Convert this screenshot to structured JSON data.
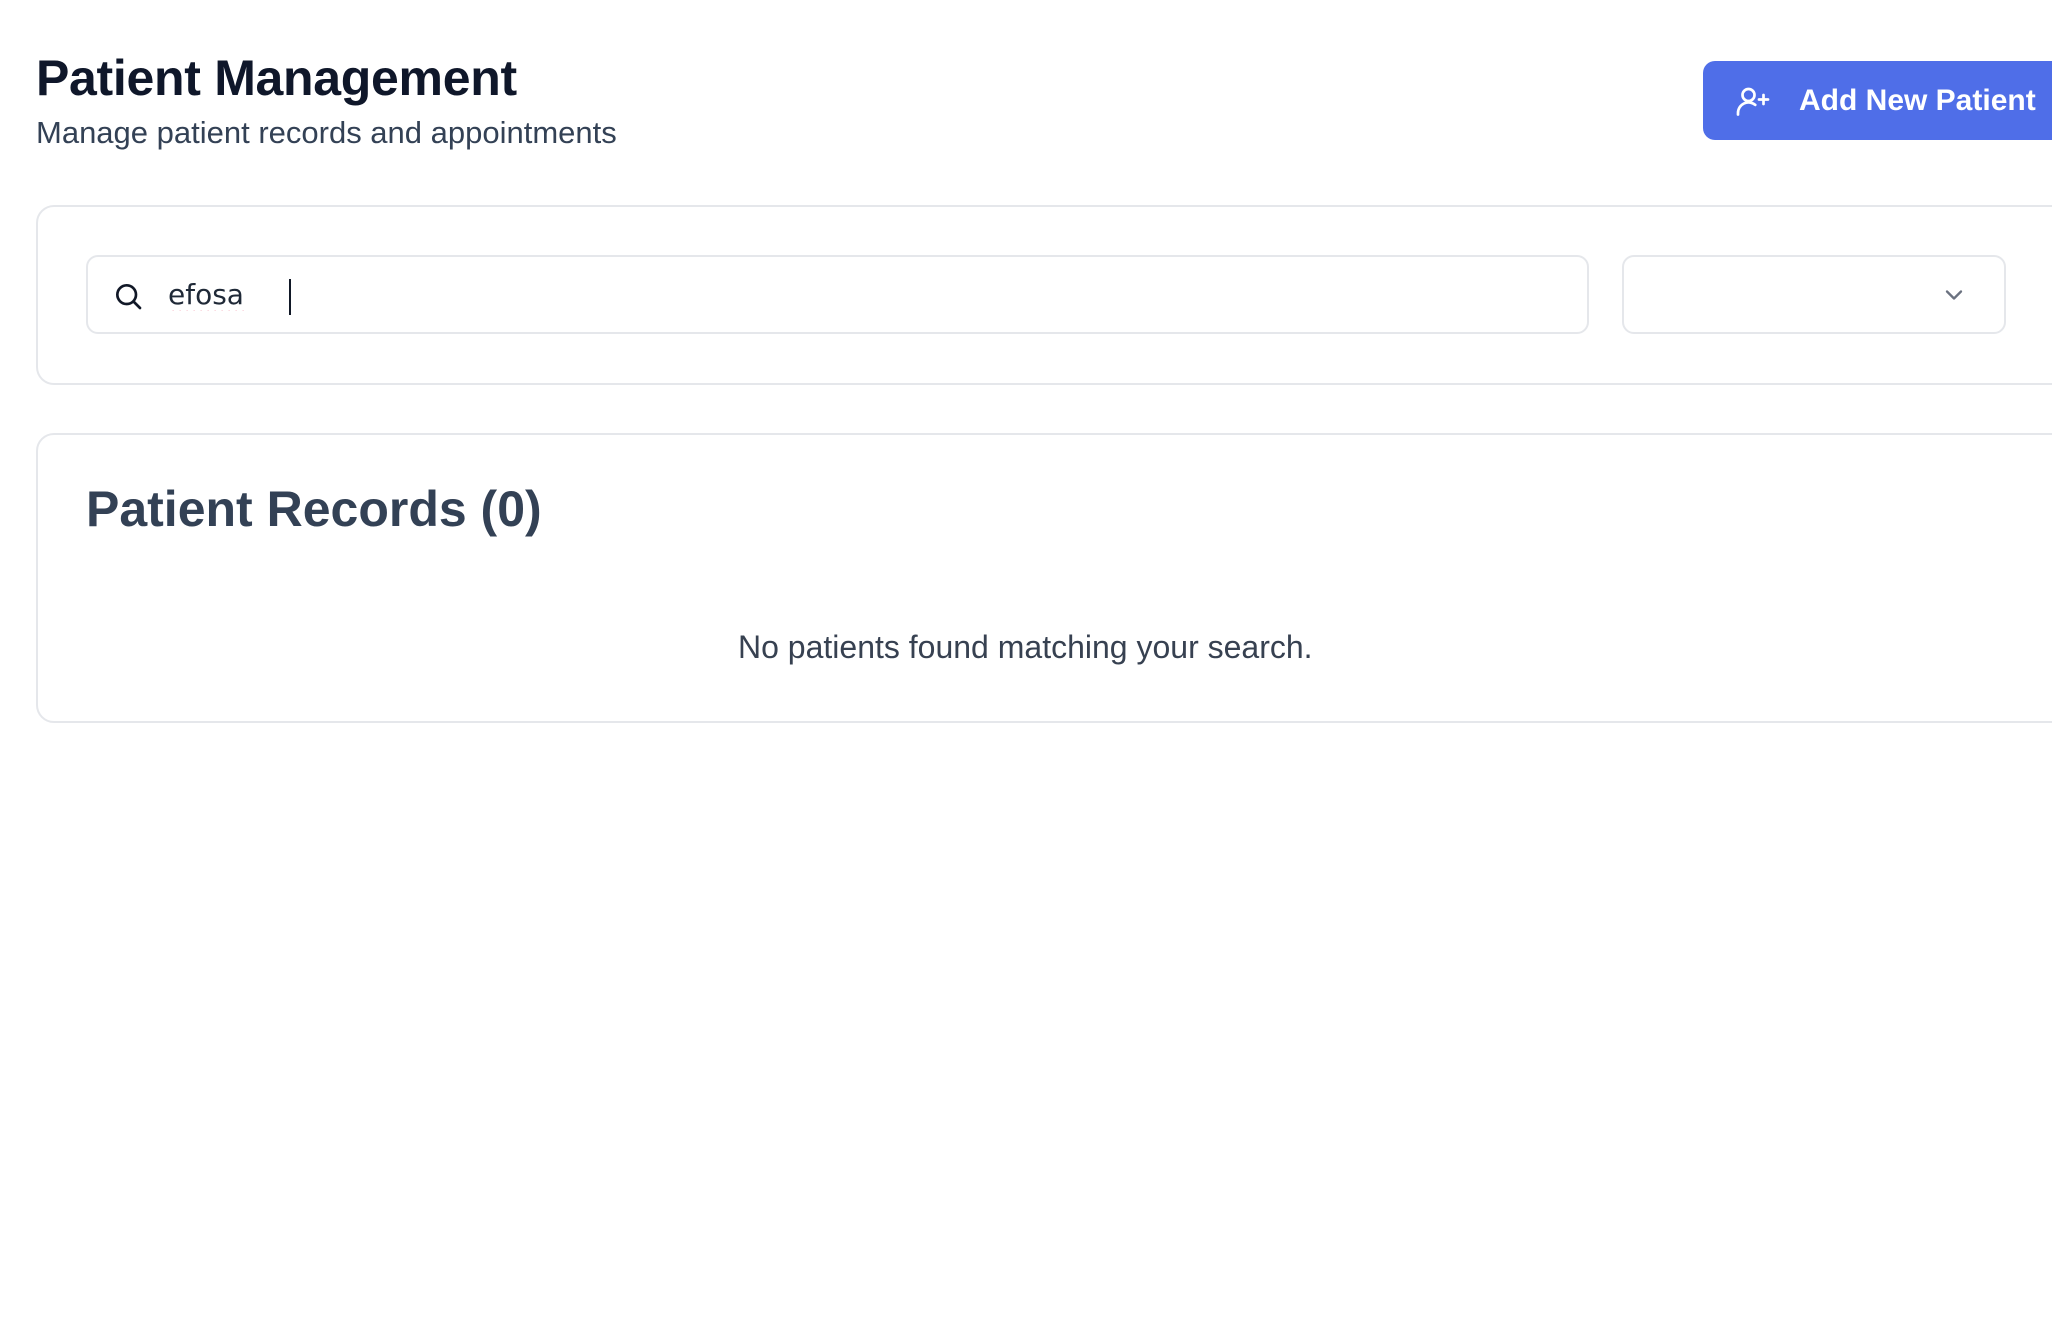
{
  "header": {
    "title": "Patient Management",
    "subtitle": "Manage patient records and appointments"
  },
  "actions": {
    "add_patient_label": "Add New Patient",
    "add_patient_icon": "user-plus-icon"
  },
  "filters": {
    "search": {
      "value": "efosa",
      "icon": "search-icon"
    },
    "status_select": {
      "selected": "",
      "icon": "chevron-down-icon"
    }
  },
  "records": {
    "title": "Patient Records (0)",
    "empty_message": "No patients found matching your search."
  },
  "colors": {
    "accent": "#4f6ee8",
    "border": "#e5e7eb",
    "title": "#0f172a",
    "muted": "#334155"
  }
}
